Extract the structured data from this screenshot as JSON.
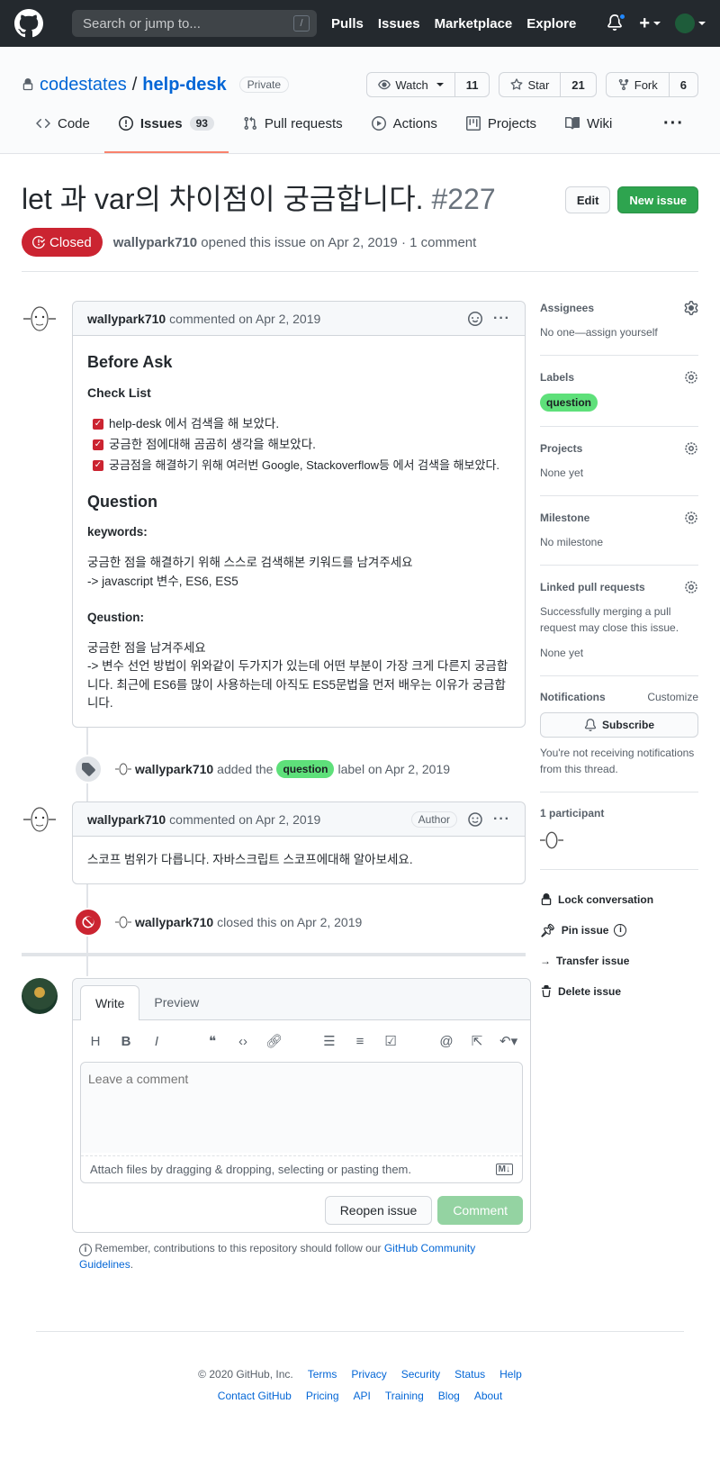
{
  "header": {
    "search_placeholder": "Search or jump to...",
    "slash": "/",
    "nav": [
      "Pulls",
      "Issues",
      "Marketplace",
      "Explore"
    ]
  },
  "repo": {
    "owner": "codestates",
    "separator": "/",
    "name": "help-desk",
    "visibility": "Private",
    "watch_label": "Watch",
    "watch_count": "11",
    "star_label": "Star",
    "star_count": "21",
    "fork_label": "Fork",
    "fork_count": "6"
  },
  "tabs": [
    {
      "label": "Code"
    },
    {
      "label": "Issues",
      "count": "93"
    },
    {
      "label": "Pull requests"
    },
    {
      "label": "Actions"
    },
    {
      "label": "Projects"
    },
    {
      "label": "Wiki"
    }
  ],
  "issue": {
    "title": "let 과 var의 차이점이 궁금합니다.",
    "number": "#227",
    "edit_label": "Edit",
    "new_issue_label": "New issue",
    "state": "Closed",
    "author": "wallypark710",
    "meta_text": "opened this issue on Apr 2, 2019 · 1 comment"
  },
  "comment1": {
    "author": "wallypark710",
    "action": "commented",
    "date": "on Apr 2, 2019",
    "h_before": "Before Ask",
    "h_checklist": "Check List",
    "checklist": [
      "help-desk 에서 검색을 해 보았다.",
      "궁금한 점에대해 곰곰히 생각을 해보았다.",
      "궁금점을 해결하기 위해 여러번 Google, Stackoverflow등 에서 검색을 해보았다."
    ],
    "h_question": "Question",
    "keywords_label": "keywords:",
    "keywords_line1": "궁금한 점을 해결하기 위해 스스로 검색해본 키워드를 남겨주세요",
    "keywords_line2": "-> javascript 변수, ES6, ES5",
    "qeustion_label": "Qeustion:",
    "question_line1": "궁금한 점을 남겨주세요",
    "question_line2": "-> 변수 선언 방법이 위와같이 두가지가 있는데 어떤 부분이 가장 크게 다른지 궁금합니다. 최근에 ES6를 많이 사용하는데 아직도 ES5문법을 먼저 배우는 이유가 궁금합니다."
  },
  "event_label": {
    "author": "wallypark710",
    "text_before": "added the",
    "label": "question",
    "text_after": "label on Apr 2, 2019"
  },
  "comment2": {
    "author": "wallypark710",
    "action": "commented",
    "date": "on Apr 2, 2019",
    "badge": "Author",
    "body": "스코프 범위가 다릅니다. 자바스크립트 스코프에대해 알아보세요."
  },
  "event_closed": {
    "author": "wallypark710",
    "text": "closed this on Apr 2, 2019"
  },
  "form": {
    "tab_write": "Write",
    "tab_preview": "Preview",
    "placeholder": "Leave a comment",
    "attach": "Attach files by dragging & dropping, selecting or pasting them.",
    "reopen": "Reopen issue",
    "comment": "Comment",
    "reminder_text": "Remember, contributions to this repository should follow our",
    "reminder_link": "GitHub Community Guidelines",
    "reminder_end": "."
  },
  "sidebar": {
    "assignees_head": "Assignees",
    "assignees_text": "No one—assign yourself",
    "labels_head": "Labels",
    "label": "question",
    "projects_head": "Projects",
    "projects_text": "None yet",
    "milestone_head": "Milestone",
    "milestone_text": "No milestone",
    "linked_head": "Linked pull requests",
    "linked_text": "Successfully merging a pull request may close this issue.",
    "linked_none": "None yet",
    "notif_head": "Notifications",
    "customize": "Customize",
    "subscribe": "Subscribe",
    "notif_text": "You're not receiving notifications from this thread.",
    "participants": "1 participant",
    "lock": "Lock conversation",
    "pin": "Pin issue",
    "transfer": "Transfer issue",
    "delete": "Delete issue"
  },
  "footer": {
    "copyright": "© 2020 GitHub, Inc.",
    "links1": [
      "Terms",
      "Privacy",
      "Security",
      "Status",
      "Help"
    ],
    "links2": [
      "Contact GitHub",
      "Pricing",
      "API",
      "Training",
      "Blog",
      "About"
    ]
  },
  "colors": {
    "closed": "#cb2431",
    "label_question": "#5ee07a",
    "primary_green": "#2ea44f",
    "link_blue": "#0366d6"
  }
}
